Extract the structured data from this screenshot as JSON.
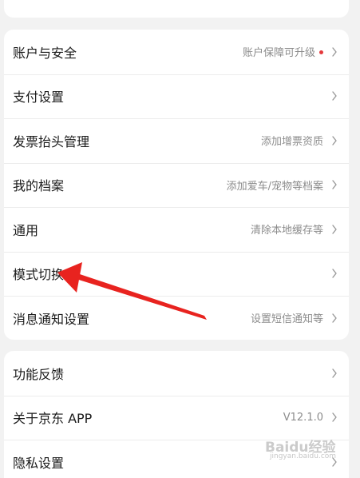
{
  "top_card": {
    "label": "─ ─ ─ ─"
  },
  "group1": [
    {
      "label": "账户与安全",
      "value": "账户保障可升级",
      "dot": true
    },
    {
      "label": "支付设置",
      "value": ""
    },
    {
      "label": "发票抬头管理",
      "value": "添加增票资质"
    },
    {
      "label": "我的档案",
      "value": "添加爱车/宠物等档案"
    },
    {
      "label": "通用",
      "value": "清除本地缓存等"
    },
    {
      "label": "模式切换",
      "value": ""
    },
    {
      "label": "消息通知设置",
      "value": "设置短信通知等"
    }
  ],
  "group2": [
    {
      "label": "功能反馈",
      "value": ""
    },
    {
      "label": "关于京东 APP",
      "value": "V12.1.0"
    },
    {
      "label": "隐私设置",
      "value": ""
    }
  ],
  "watermark": {
    "brand": "Baidu经验",
    "url": "jingyan.baidu.com"
  },
  "colors": {
    "background": "#f2f2f2",
    "card": "#ffffff",
    "dot": "#e4393c",
    "annotation_arrow": "#e8231f"
  },
  "icons": {
    "chevron": "chevron-right-icon",
    "annotation": "red-arrow-annotation"
  }
}
